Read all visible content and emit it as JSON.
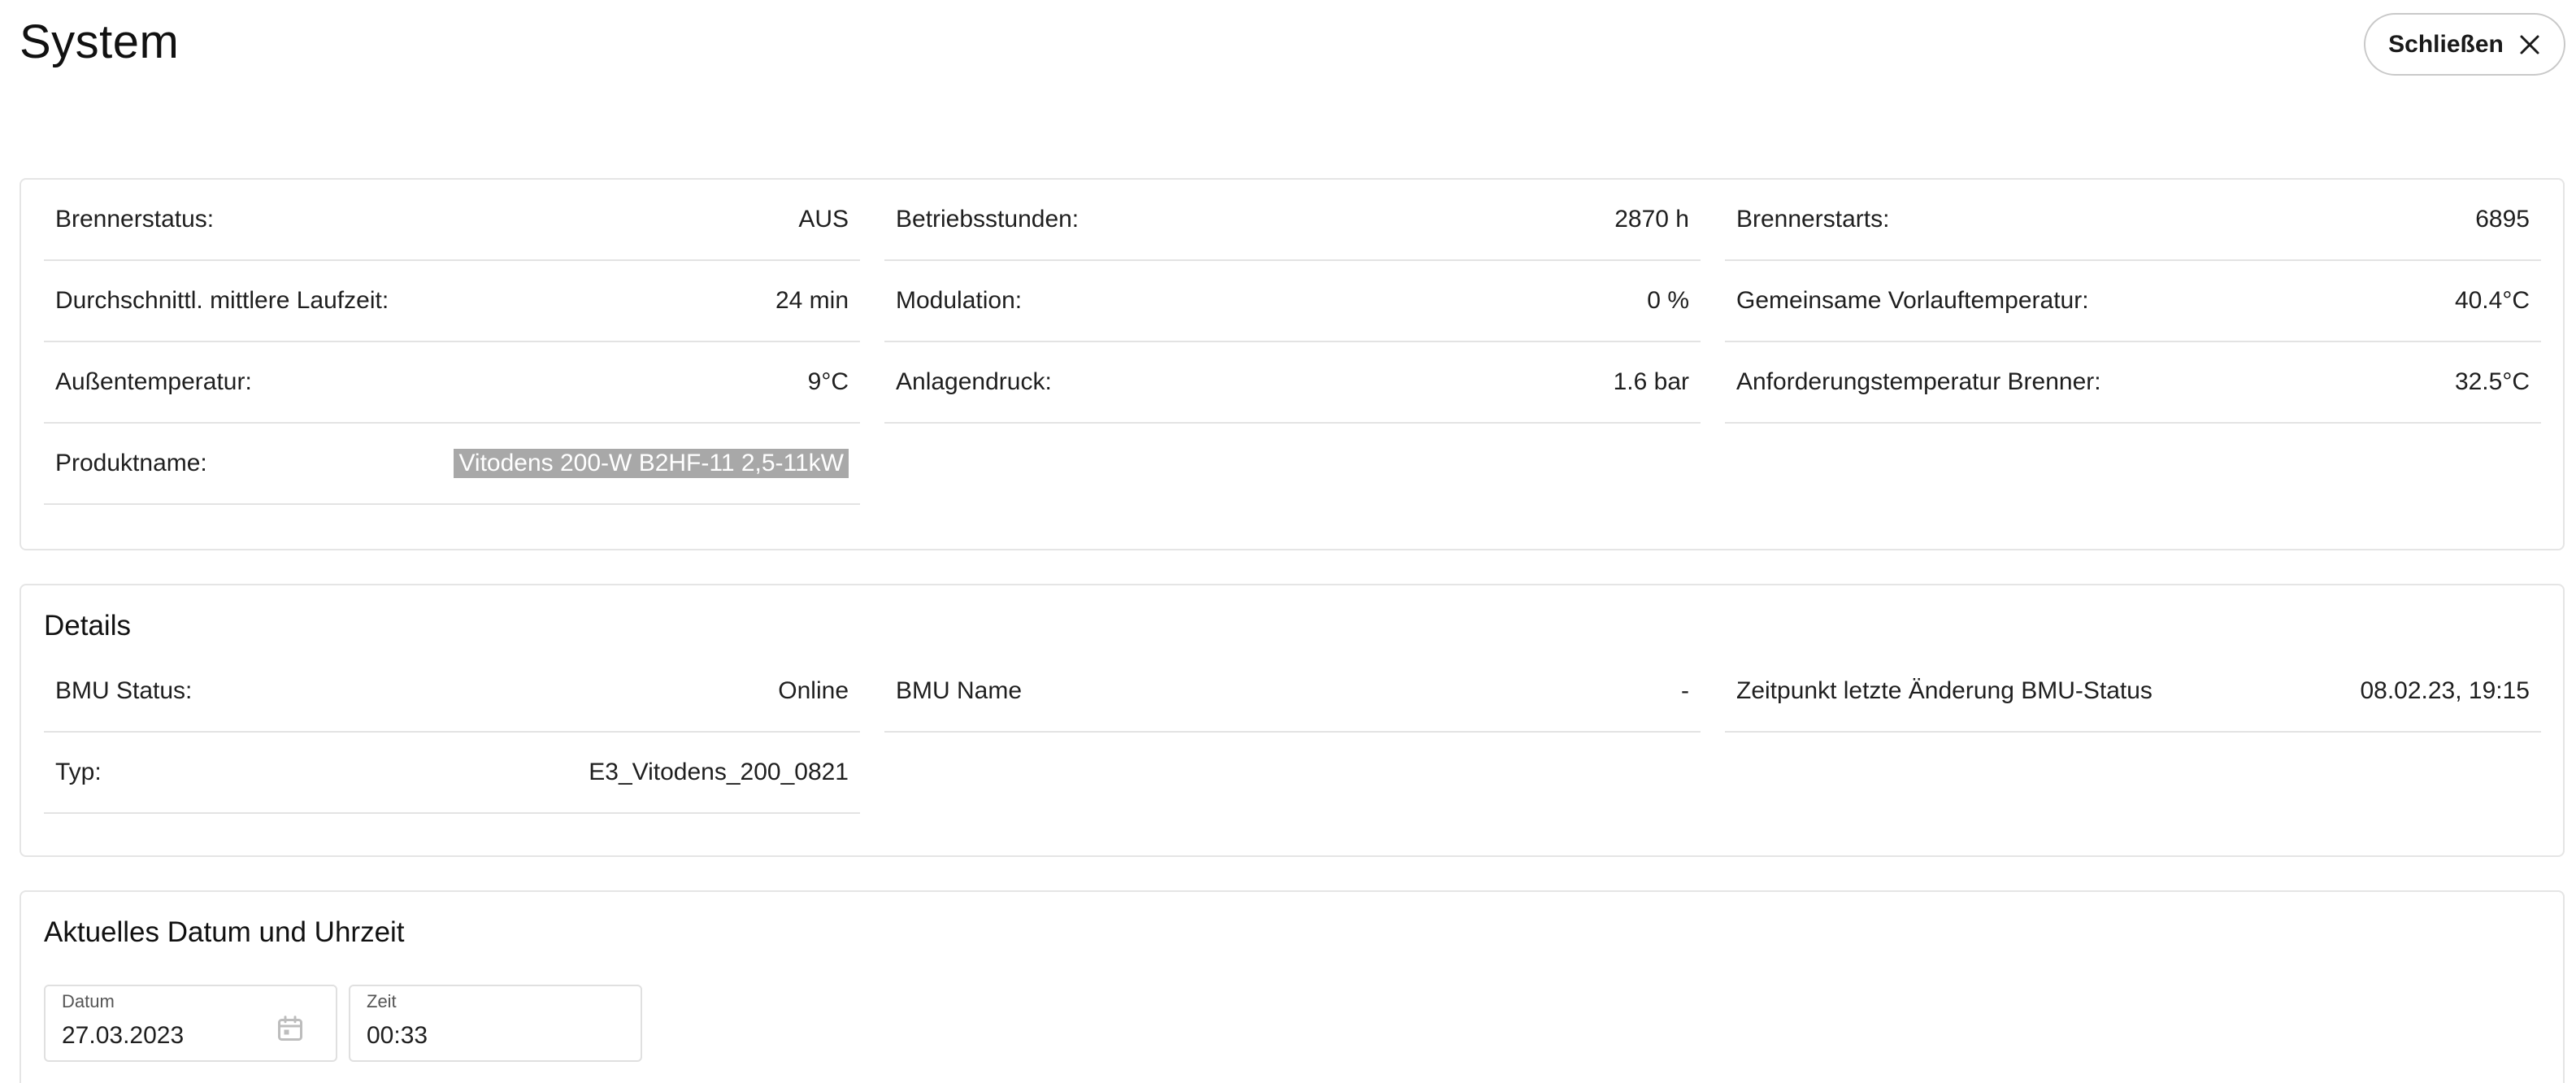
{
  "header": {
    "title": "System",
    "close_label": "Schließen"
  },
  "system": {
    "rows": [
      {
        "label": "Brennerstatus:",
        "value": "AUS"
      },
      {
        "label": "Betriebsstunden:",
        "value": "2870 h"
      },
      {
        "label": "Brennerstarts:",
        "value": "6895"
      },
      {
        "label": "Durchschnittl. mittlere Laufzeit:",
        "value": "24 min"
      },
      {
        "label": "Modulation:",
        "value": "0 %"
      },
      {
        "label": "Gemeinsame Vorlauftemperatur:",
        "value": "40.4°C"
      },
      {
        "label": "Außentemperatur:",
        "value": "9°C"
      },
      {
        "label": "Anlagendruck:",
        "value": "1.6 bar"
      },
      {
        "label": "Anforderungstemperatur Brenner:",
        "value": "32.5°C"
      },
      {
        "label": "Produktname:",
        "value": "Vitodens 200-W B2HF-11 2,5-11kW"
      }
    ]
  },
  "details": {
    "heading": "Details",
    "rows": [
      {
        "label": "BMU Status:",
        "value": "Online"
      },
      {
        "label": "BMU Name",
        "value": "-"
      },
      {
        "label": "Zeitpunkt letzte Änderung BMU-Status",
        "value": "08.02.23, 19:15"
      },
      {
        "label": "Typ:",
        "value": "E3_Vitodens_200_0821"
      }
    ]
  },
  "datetime": {
    "heading": "Aktuelles Datum und Uhrzeit",
    "date_label": "Datum",
    "date_value": "27.03.2023",
    "time_label": "Zeit",
    "time_value": "00:33"
  },
  "icons": {
    "close": "close-icon",
    "calendar": "calendar-icon"
  },
  "colors": {
    "selection": "#a8a8a8",
    "border": "#e5e5e5"
  }
}
